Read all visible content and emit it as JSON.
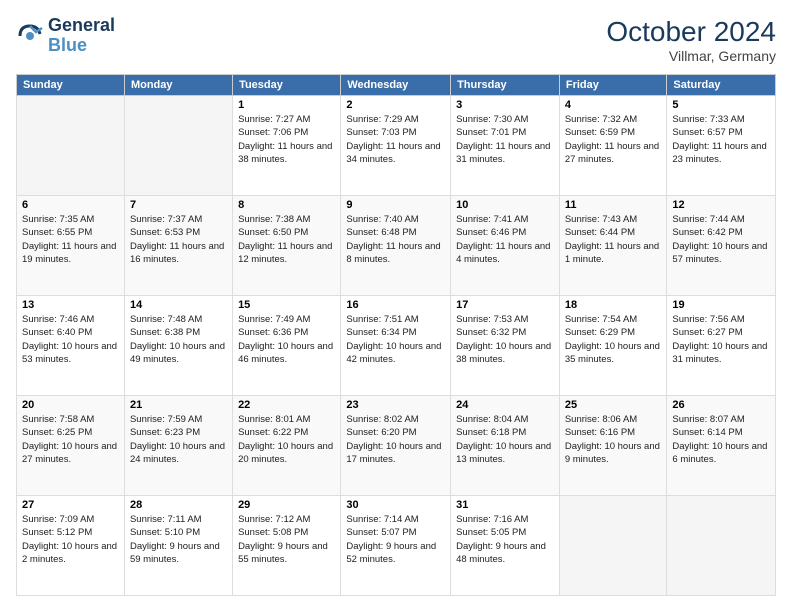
{
  "header": {
    "logo_line1": "General",
    "logo_line2": "Blue",
    "month_title": "October 2024",
    "subtitle": "Villmar, Germany"
  },
  "weekdays": [
    "Sunday",
    "Monday",
    "Tuesday",
    "Wednesday",
    "Thursday",
    "Friday",
    "Saturday"
  ],
  "weeks": [
    [
      {
        "day": "",
        "info": ""
      },
      {
        "day": "",
        "info": ""
      },
      {
        "day": "1",
        "info": "Sunrise: 7:27 AM\nSunset: 7:06 PM\nDaylight: 11 hours and 38 minutes."
      },
      {
        "day": "2",
        "info": "Sunrise: 7:29 AM\nSunset: 7:03 PM\nDaylight: 11 hours and 34 minutes."
      },
      {
        "day": "3",
        "info": "Sunrise: 7:30 AM\nSunset: 7:01 PM\nDaylight: 11 hours and 31 minutes."
      },
      {
        "day": "4",
        "info": "Sunrise: 7:32 AM\nSunset: 6:59 PM\nDaylight: 11 hours and 27 minutes."
      },
      {
        "day": "5",
        "info": "Sunrise: 7:33 AM\nSunset: 6:57 PM\nDaylight: 11 hours and 23 minutes."
      }
    ],
    [
      {
        "day": "6",
        "info": "Sunrise: 7:35 AM\nSunset: 6:55 PM\nDaylight: 11 hours and 19 minutes."
      },
      {
        "day": "7",
        "info": "Sunrise: 7:37 AM\nSunset: 6:53 PM\nDaylight: 11 hours and 16 minutes."
      },
      {
        "day": "8",
        "info": "Sunrise: 7:38 AM\nSunset: 6:50 PM\nDaylight: 11 hours and 12 minutes."
      },
      {
        "day": "9",
        "info": "Sunrise: 7:40 AM\nSunset: 6:48 PM\nDaylight: 11 hours and 8 minutes."
      },
      {
        "day": "10",
        "info": "Sunrise: 7:41 AM\nSunset: 6:46 PM\nDaylight: 11 hours and 4 minutes."
      },
      {
        "day": "11",
        "info": "Sunrise: 7:43 AM\nSunset: 6:44 PM\nDaylight: 11 hours and 1 minute."
      },
      {
        "day": "12",
        "info": "Sunrise: 7:44 AM\nSunset: 6:42 PM\nDaylight: 10 hours and 57 minutes."
      }
    ],
    [
      {
        "day": "13",
        "info": "Sunrise: 7:46 AM\nSunset: 6:40 PM\nDaylight: 10 hours and 53 minutes."
      },
      {
        "day": "14",
        "info": "Sunrise: 7:48 AM\nSunset: 6:38 PM\nDaylight: 10 hours and 49 minutes."
      },
      {
        "day": "15",
        "info": "Sunrise: 7:49 AM\nSunset: 6:36 PM\nDaylight: 10 hours and 46 minutes."
      },
      {
        "day": "16",
        "info": "Sunrise: 7:51 AM\nSunset: 6:34 PM\nDaylight: 10 hours and 42 minutes."
      },
      {
        "day": "17",
        "info": "Sunrise: 7:53 AM\nSunset: 6:32 PM\nDaylight: 10 hours and 38 minutes."
      },
      {
        "day": "18",
        "info": "Sunrise: 7:54 AM\nSunset: 6:29 PM\nDaylight: 10 hours and 35 minutes."
      },
      {
        "day": "19",
        "info": "Sunrise: 7:56 AM\nSunset: 6:27 PM\nDaylight: 10 hours and 31 minutes."
      }
    ],
    [
      {
        "day": "20",
        "info": "Sunrise: 7:58 AM\nSunset: 6:25 PM\nDaylight: 10 hours and 27 minutes."
      },
      {
        "day": "21",
        "info": "Sunrise: 7:59 AM\nSunset: 6:23 PM\nDaylight: 10 hours and 24 minutes."
      },
      {
        "day": "22",
        "info": "Sunrise: 8:01 AM\nSunset: 6:22 PM\nDaylight: 10 hours and 20 minutes."
      },
      {
        "day": "23",
        "info": "Sunrise: 8:02 AM\nSunset: 6:20 PM\nDaylight: 10 hours and 17 minutes."
      },
      {
        "day": "24",
        "info": "Sunrise: 8:04 AM\nSunset: 6:18 PM\nDaylight: 10 hours and 13 minutes."
      },
      {
        "day": "25",
        "info": "Sunrise: 8:06 AM\nSunset: 6:16 PM\nDaylight: 10 hours and 9 minutes."
      },
      {
        "day": "26",
        "info": "Sunrise: 8:07 AM\nSunset: 6:14 PM\nDaylight: 10 hours and 6 minutes."
      }
    ],
    [
      {
        "day": "27",
        "info": "Sunrise: 7:09 AM\nSunset: 5:12 PM\nDaylight: 10 hours and 2 minutes."
      },
      {
        "day": "28",
        "info": "Sunrise: 7:11 AM\nSunset: 5:10 PM\nDaylight: 9 hours and 59 minutes."
      },
      {
        "day": "29",
        "info": "Sunrise: 7:12 AM\nSunset: 5:08 PM\nDaylight: 9 hours and 55 minutes."
      },
      {
        "day": "30",
        "info": "Sunrise: 7:14 AM\nSunset: 5:07 PM\nDaylight: 9 hours and 52 minutes."
      },
      {
        "day": "31",
        "info": "Sunrise: 7:16 AM\nSunset: 5:05 PM\nDaylight: 9 hours and 48 minutes."
      },
      {
        "day": "",
        "info": ""
      },
      {
        "day": "",
        "info": ""
      }
    ]
  ]
}
